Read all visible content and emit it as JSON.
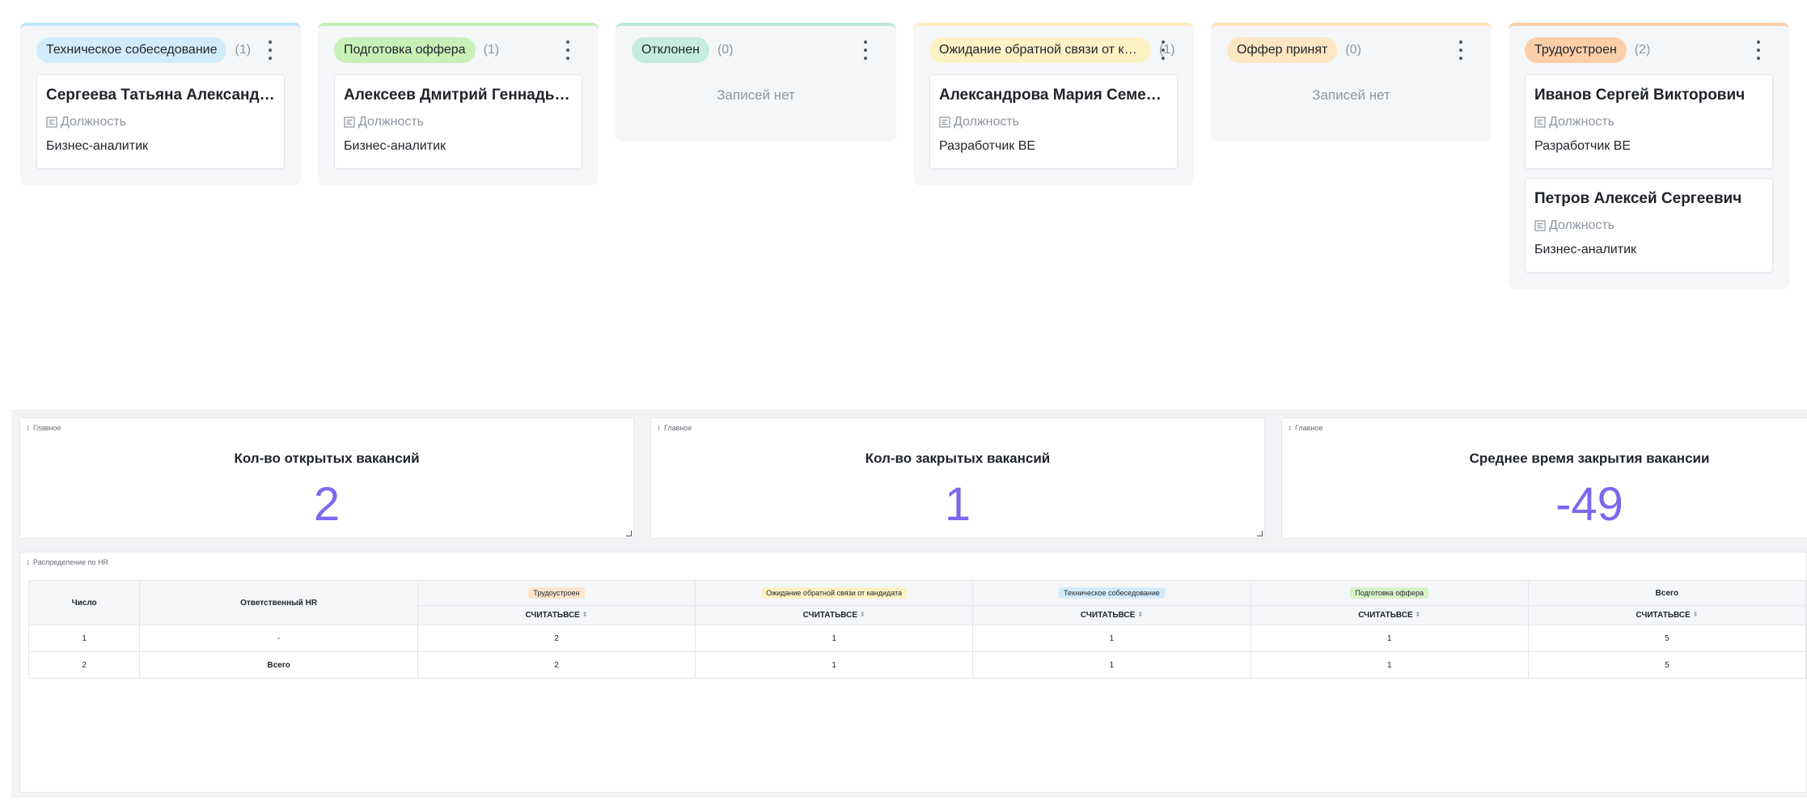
{
  "kanban": {
    "field_label": "Должность",
    "empty_text": "Записей нет",
    "columns": [
      {
        "status": "Техническое собеседование",
        "count": "(1)",
        "bar_color": "#bfe5f7",
        "badge_color": "#d3ecfb",
        "cards": [
          {
            "name": "Сергеева Татьяна Александровна",
            "position": "Бизнес-аналитик"
          }
        ]
      },
      {
        "status": "Подготовка оффера",
        "count": "(1)",
        "bar_color": "#c4eeb4",
        "badge_color": "#c9f0b6",
        "cards": [
          {
            "name": "Алексеев Дмитрий Геннадьевич",
            "position": "Бизнес-аналитик"
          }
        ]
      },
      {
        "status": "Отклонен",
        "count": "(0)",
        "bar_color": "#bde9db",
        "badge_color": "#c5eddf",
        "cards": []
      },
      {
        "status": "Ожидание обратной связи от кандидата",
        "count": "(1)",
        "bar_color": "#fdf0c0",
        "badge_color": "#fdf1c6",
        "cards": [
          {
            "name": "Александрова Мария Семеновна",
            "position": "Разработчик BE"
          }
        ]
      },
      {
        "status": "Оффер принят",
        "count": "(0)",
        "bar_color": "#fde2b9",
        "badge_color": "#fde6c2",
        "cards": []
      },
      {
        "status": "Трудоустроен",
        "count": "(2)",
        "bar_color": "#fbd0aa",
        "badge_color": "#fccfa8",
        "cards": [
          {
            "name": "Иванов Сергей Викторович",
            "position": "Разработчик BE"
          },
          {
            "name": "Петров Алексей Сергеевич",
            "position": "Бизнес-аналитик"
          }
        ]
      }
    ]
  },
  "dashboard": {
    "accent_color": "#7b68ee",
    "kpis": [
      {
        "tag": "Главное",
        "title": "Кол-во открытых вакансий",
        "value": "2"
      },
      {
        "tag": "Главное",
        "title": "Кол-во закрытых вакансий",
        "value": "1"
      },
      {
        "tag": "Главное",
        "title": "Среднее время закрытия вакансии",
        "value": "-49"
      }
    ],
    "table": {
      "tag": "Распределение по HR",
      "col_number": "Число",
      "col_hr": "Ответственный HR",
      "groups": [
        {
          "label": "Трудоустроен",
          "color": "#fde4cc"
        },
        {
          "label": "Ожидание обратной связи от кандидата",
          "color": "#fdf1c6"
        },
        {
          "label": "Техническое собеседование",
          "color": "#d3ecfb"
        },
        {
          "label": "Подготовка оффера",
          "color": "#d7f3c8"
        },
        {
          "label": "Всего",
          "color": ""
        }
      ],
      "sub_label": "СЧИТАТЬВСЕ",
      "rows": [
        {
          "num": "1",
          "hr": "-",
          "values": [
            "2",
            "1",
            "1",
            "1",
            "5"
          ]
        },
        {
          "num": "2",
          "hr": "Всего",
          "values": [
            "2",
            "1",
            "1",
            "1",
            "5"
          ]
        }
      ]
    }
  }
}
